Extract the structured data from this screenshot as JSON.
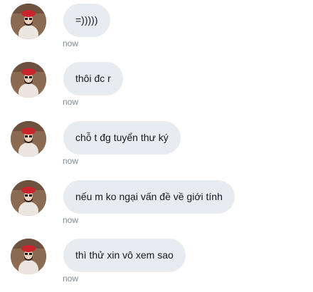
{
  "messages": [
    {
      "text": "=)))))",
      "time": "now"
    },
    {
      "text": "thôi đc r",
      "time": "now"
    },
    {
      "text": "chỗ t đg tuyển thư ký",
      "time": "now"
    },
    {
      "text": "nếu m ko ngại vấn đề về giới tính",
      "time": "now"
    },
    {
      "text": "thì thử xin vô xem sao",
      "time": "now"
    }
  ],
  "colors": {
    "bubble_background": "#e8ebf0",
    "message_text": "#16181c",
    "timestamp_text": "#7b8a96",
    "avatar_beret": "#c8252d"
  },
  "icons": {
    "avatar": "profile-photo-red-beret"
  }
}
